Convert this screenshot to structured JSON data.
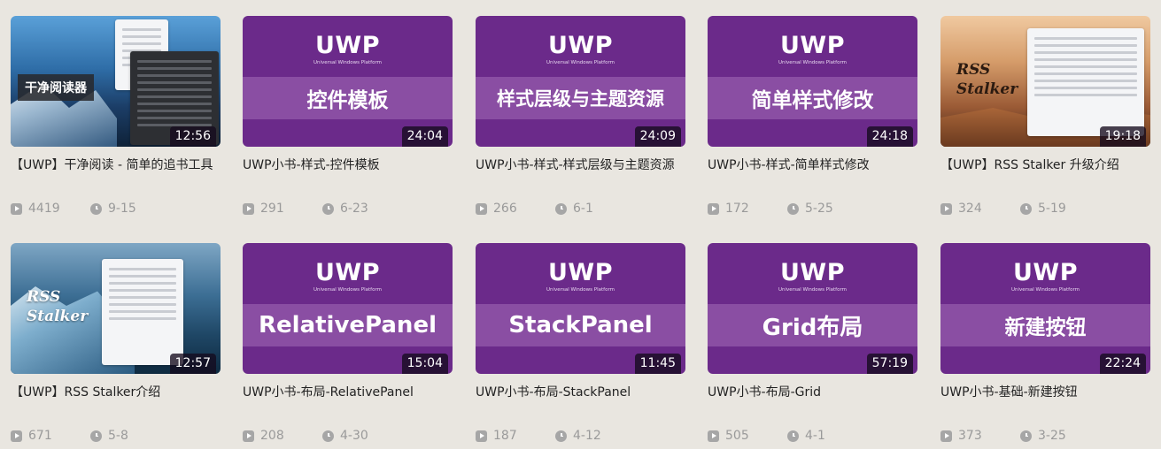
{
  "videos": [
    {
      "title": "【UWP】干净阅读 - 简单的追书工具",
      "duration": "12:56",
      "views": "4419",
      "date": "9-15",
      "thumb": {
        "kind": "photo",
        "label": "干净阅读器"
      }
    },
    {
      "title": "UWP小书-样式-控件模板",
      "duration": "24:04",
      "views": "291",
      "date": "6-23",
      "thumb": {
        "kind": "uwp",
        "heading": "UWP",
        "sub": "Universal Windows Platform",
        "band": "控件模板"
      }
    },
    {
      "title": "UWP小书-样式-样式层级与主题资源",
      "duration": "24:09",
      "views": "266",
      "date": "6-1",
      "thumb": {
        "kind": "uwp",
        "heading": "UWP",
        "sub": "Universal Windows Platform",
        "band": "样式层级与主题资源"
      }
    },
    {
      "title": "UWP小书-样式-简单样式修改",
      "duration": "24:18",
      "views": "172",
      "date": "5-25",
      "thumb": {
        "kind": "uwp",
        "heading": "UWP",
        "sub": "Universal Windows Platform",
        "band": "简单样式修改"
      }
    },
    {
      "title": "【UWP】RSS Stalker 升级介绍",
      "duration": "19:18",
      "views": "324",
      "date": "5-19",
      "thumb": {
        "kind": "photo",
        "label": "RSS Stalker"
      }
    },
    {
      "title": "【UWP】RSS Stalker介绍",
      "duration": "12:57",
      "views": "671",
      "date": "5-8",
      "thumb": {
        "kind": "photo",
        "label": "RSS Stalker"
      }
    },
    {
      "title": "UWP小书-布局-RelativePanel",
      "duration": "15:04",
      "views": "208",
      "date": "4-30",
      "thumb": {
        "kind": "uwp",
        "heading": "UWP",
        "sub": "Universal Windows Platform",
        "band": "RelativePanel"
      }
    },
    {
      "title": "UWP小书-布局-StackPanel",
      "duration": "11:45",
      "views": "187",
      "date": "4-12",
      "thumb": {
        "kind": "uwp",
        "heading": "UWP",
        "sub": "Universal Windows Platform",
        "band": "StackPanel"
      }
    },
    {
      "title": "UWP小书-布局-Grid",
      "duration": "57:19",
      "views": "505",
      "date": "4-1",
      "thumb": {
        "kind": "uwp",
        "heading": "UWP",
        "sub": "Universal Windows Platform",
        "band": "Grid布局"
      }
    },
    {
      "title": "UWP小书-基础-新建按钮",
      "duration": "22:24",
      "views": "373",
      "date": "3-25",
      "thumb": {
        "kind": "uwp",
        "heading": "UWP",
        "sub": "Universal Windows Platform",
        "band": "新建按钮"
      }
    }
  ],
  "colors": {
    "uwp_purple": "#6b2a8a",
    "uwp_band": "#8a4ea3",
    "meta_gray": "#9a9a9a",
    "page_bg": "#e9e6e0"
  },
  "icons": {
    "views": "play-count-icon",
    "date": "clock-icon"
  }
}
